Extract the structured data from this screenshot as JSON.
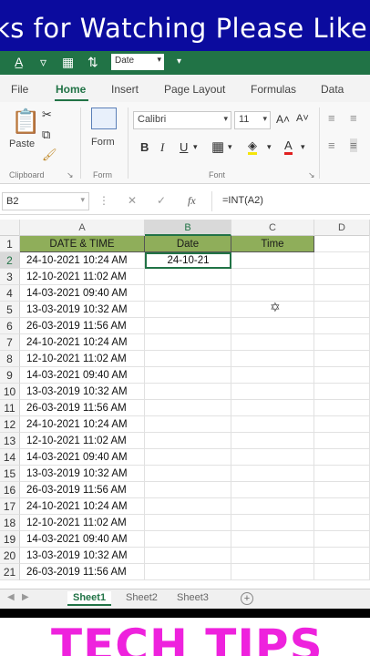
{
  "banner": {
    "text": "ks for Watching Please Like"
  },
  "qat": {
    "format_value": "Date",
    "icons": [
      "text-color-icon",
      "filter-icon",
      "table-icon",
      "sort-icon",
      "dropdown-icon"
    ]
  },
  "ribbon": {
    "tabs": [
      "File",
      "Home",
      "Insert",
      "Page Layout",
      "Formulas",
      "Data"
    ],
    "active_tab": "Home",
    "clipboard": {
      "paste_label": "Paste",
      "group_label": "Clipboard"
    },
    "form": {
      "button_label": "Form",
      "group_label": "Form"
    },
    "font": {
      "name": "Calibri",
      "size": "11",
      "group_label": "Font",
      "bold": "B",
      "italic": "I",
      "underline": "U",
      "grow": "A˄",
      "shrink": "A˅"
    }
  },
  "formula_bar": {
    "name_box": "B2",
    "fx": "fx",
    "formula": "=INT(A2)"
  },
  "grid": {
    "columns": [
      "A",
      "B",
      "C",
      "D"
    ],
    "header_row": {
      "date_time": "DATE & TIME",
      "date": "Date",
      "time": "Time"
    },
    "selected_value": "24-10-21",
    "rows": [
      "24-10-2021 10:24 AM",
      "12-10-2021 11:02 AM",
      "14-03-2021 09:40 AM",
      "13-03-2019 10:32 AM",
      "26-03-2019 11:56 AM",
      "24-10-2021 10:24 AM",
      "12-10-2021 11:02 AM",
      "14-03-2021 09:40 AM",
      "13-03-2019 10:32 AM",
      "26-03-2019 11:56 AM",
      "24-10-2021 10:24 AM",
      "12-10-2021 11:02 AM",
      "14-03-2021 09:40 AM",
      "13-03-2019 10:32 AM",
      "26-03-2019 11:56 AM",
      "24-10-2021 10:24 AM",
      "12-10-2021 11:02 AM",
      "14-03-2021 09:40 AM",
      "13-03-2019 10:32 AM",
      "26-03-2019 11:56 AM"
    ]
  },
  "sheets": {
    "tabs": [
      "Sheet1",
      "Sheet2",
      "Sheet3"
    ],
    "active": "Sheet1",
    "add": "+"
  },
  "footer": {
    "text": "TECH TIPS"
  },
  "colors": {
    "excel_green": "#217346",
    "header_fill": "#8fae5a",
    "banner": "#0b0b9e",
    "tech_tips": "#ee22dd"
  }
}
